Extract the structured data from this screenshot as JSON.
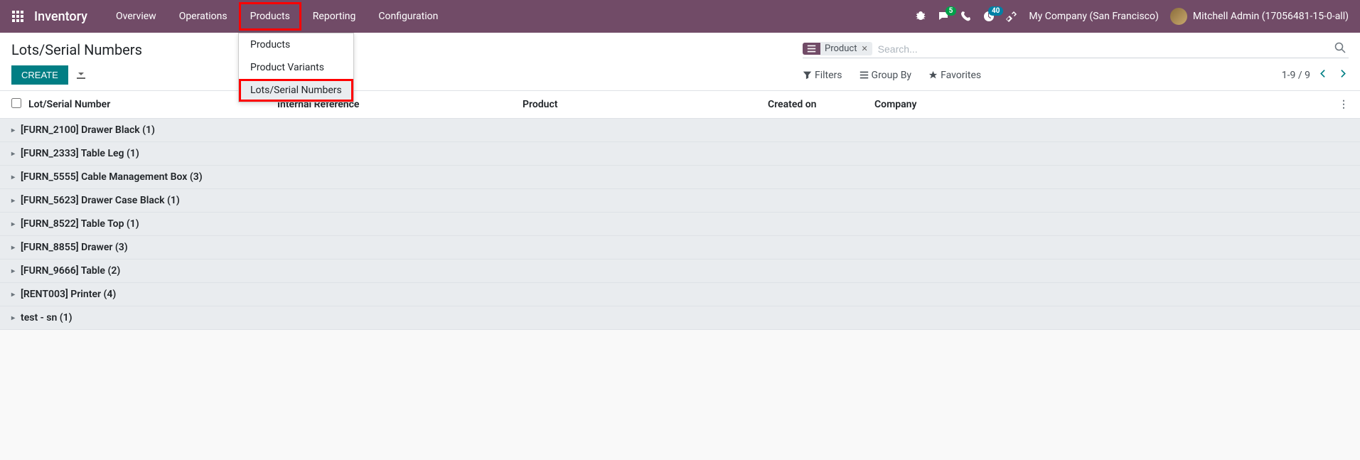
{
  "nav": {
    "brand": "Inventory",
    "items": [
      "Overview",
      "Operations",
      "Products",
      "Reporting",
      "Configuration"
    ],
    "highlighted_index": 2,
    "dropdown": {
      "items": [
        "Products",
        "Product Variants",
        "Lots/Serial Numbers"
      ],
      "hovered_index": 2
    },
    "chat_badge": "5",
    "clock_badge": "40",
    "company": "My Company (San Francisco)",
    "user": "Mitchell Admin (17056481-15-0-all)"
  },
  "page": {
    "title": "Lots/Serial Numbers",
    "create_label": "CREATE"
  },
  "search": {
    "facet_label": "Product",
    "placeholder": "Search...",
    "filters_label": "Filters",
    "groupby_label": "Group By",
    "favorites_label": "Favorites"
  },
  "pager": {
    "range": "1-9 / 9"
  },
  "columns": {
    "lot": "Lot/Serial Number",
    "ref": "Internal Reference",
    "product": "Product",
    "created": "Created on",
    "company": "Company"
  },
  "groups": [
    {
      "label": "[FURN_2100] Drawer Black (1)"
    },
    {
      "label": "[FURN_2333] Table Leg (1)"
    },
    {
      "label": "[FURN_5555] Cable Management Box (3)"
    },
    {
      "label": "[FURN_5623] Drawer Case Black (1)"
    },
    {
      "label": "[FURN_8522] Table Top (1)"
    },
    {
      "label": "[FURN_8855] Drawer (3)"
    },
    {
      "label": "[FURN_9666] Table (2)"
    },
    {
      "label": "[RENT003] Printer (4)"
    },
    {
      "label": "test - sn (1)"
    }
  ]
}
